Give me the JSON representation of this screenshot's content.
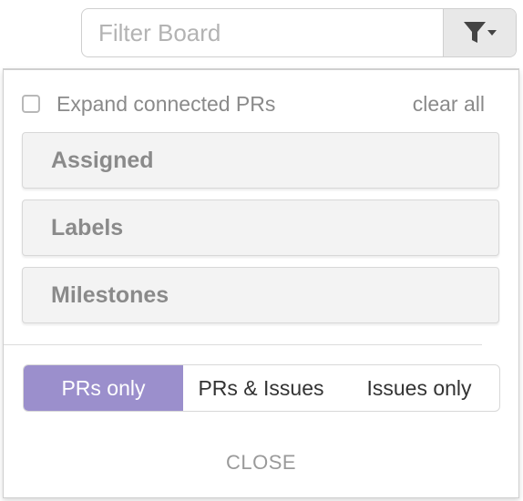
{
  "filter": {
    "placeholder": "Filter Board",
    "value": "",
    "button_icon": "filter-funnel-icon"
  },
  "panel": {
    "expand_label": "Expand connected PRs",
    "expand_checked": false,
    "clear_all": "clear all",
    "sections": [
      {
        "label": "Assigned"
      },
      {
        "label": "Labels"
      },
      {
        "label": "Milestones"
      }
    ],
    "segments": [
      {
        "label": "PRs only",
        "active": true
      },
      {
        "label": "PRs & Issues",
        "active": false
      },
      {
        "label": "Issues only",
        "active": false
      }
    ],
    "close_label": "CLOSE"
  },
  "colors": {
    "accent": "#9b8fcc",
    "muted_text": "#8a8a8a"
  }
}
